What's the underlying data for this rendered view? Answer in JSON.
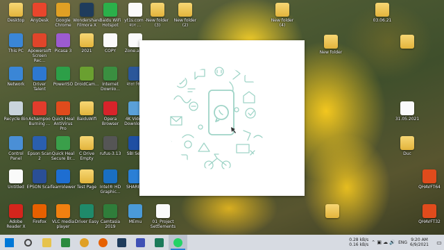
{
  "desktop": {
    "icons_col1": [
      {
        "label": "Desktop",
        "icon": "desktop-folder-icon",
        "color": "#e6c34d"
      },
      {
        "label": "This PC",
        "icon": "this-pc-icon",
        "color": "#3a86d6"
      },
      {
        "label": "Network",
        "icon": "network-icon",
        "color": "#3a86d6"
      },
      {
        "label": "Recycle Bin",
        "icon": "recycle-bin-icon",
        "color": "#c9d4dc"
      },
      {
        "label": "Control\nPanel",
        "icon": "control-panel-icon",
        "color": "#4a8fd6"
      },
      {
        "label": "Untitled",
        "icon": "untitled-file-icon",
        "color": "#f3f3f3"
      },
      {
        "label": "Adobe\nReader X",
        "icon": "adobe-reader-icon",
        "color": "#d4251c"
      }
    ],
    "icons_col2": [
      {
        "label": "AnyDesk",
        "icon": "anydesk-icon",
        "color": "#e8452c"
      },
      {
        "label": "Apowersoft\nScreen Rec...",
        "icon": "apowersoft-icon",
        "color": "#e0452a"
      },
      {
        "label": "Driver Talent",
        "icon": "driver-talent-icon",
        "color": "#2d78d0"
      },
      {
        "label": "Ashampoo\nBurning ...",
        "icon": "ashampoo-icon",
        "color": "#e23c2c"
      },
      {
        "label": "Epson Scan 2",
        "icon": "epson-scan2-icon",
        "color": "#2a5fae"
      },
      {
        "label": "EPSON Scan",
        "icon": "epson-scan-icon",
        "color": "#2a4f96"
      },
      {
        "label": "Firefox",
        "icon": "firefox-icon",
        "color": "#e66000"
      }
    ],
    "icons_col3": [
      {
        "label": "Google\nChrome",
        "icon": "chrome-icon",
        "color": "#e0a024"
      },
      {
        "label": "Picasa 3",
        "icon": "picasa-icon",
        "color": "#9c5bd0"
      },
      {
        "label": "PowerISO",
        "icon": "poweriso-icon",
        "color": "#2d9f48"
      },
      {
        "label": "Quick Heal\nAntiVirus Pro",
        "icon": "quickheal-icon",
        "color": "#e04b1c"
      },
      {
        "label": "Quick Heal\nSecure Br...",
        "icon": "quickheal-secure-icon",
        "color": "#3a9f4a"
      },
      {
        "label": "TeamViewer",
        "icon": "teamviewer-icon",
        "color": "#1e6ed1"
      },
      {
        "label": "VLC media\nplayer",
        "icon": "vlc-icon",
        "color": "#f08010"
      }
    ],
    "icons_col4": [
      {
        "label": "Wondershare\nFilmora X",
        "icon": "filmora-icon",
        "color": "#1f3c5c"
      },
      {
        "label": "2021",
        "icon": "folder-icon",
        "color": "#e6c34d"
      },
      {
        "label": "DroidCam...",
        "icon": "droidcam-icon",
        "color": "#6aa030"
      },
      {
        "label": "BaiduWifi",
        "icon": "folder-icon",
        "color": "#e6c34d"
      },
      {
        "label": "C Drive\nEmpty",
        "icon": "folder-icon",
        "color": "#e6c34d"
      },
      {
        "label": "Test Page",
        "icon": "folder-icon",
        "color": "#e6c34d"
      },
      {
        "label": "Driver Easy",
        "icon": "driver-easy-icon",
        "color": "#1f8a6a"
      }
    ],
    "icons_col5": [
      {
        "label": "Baidu WiFi\nHotspot",
        "icon": "baidu-wifi-icon",
        "color": "#2bb04a"
      },
      {
        "label": "COPY",
        "icon": "file-icon",
        "color": "#f3f3f3"
      },
      {
        "label": "Internet\nDownlo...",
        "icon": "idm-icon",
        "color": "#3a8f40"
      },
      {
        "label": "Opera\nBrowser",
        "icon": "opera-icon",
        "color": "#d8232a"
      },
      {
        "label": "rufus-3.13",
        "icon": "rufus-icon",
        "color": "#555555"
      },
      {
        "label": "Intel® HD\nGraphic...",
        "icon": "intel-graphics-icon",
        "color": "#1a6fc2"
      },
      {
        "label": "Camtasia\n2019",
        "icon": "camtasia-icon",
        "color": "#2f7d3a"
      }
    ],
    "icons_col6": [
      {
        "label": "yt1s.com -\nমনে ...",
        "icon": "music-file-icon",
        "color": "#f3f3f3"
      },
      {
        "label": "Zone.ad...",
        "icon": "file-icon",
        "color": "#f3f3f3"
      },
      {
        "label": "মাতা কি...",
        "icon": "word-file-icon",
        "color": "#2b579a"
      },
      {
        "label": "4K Vide...\nDownloa...",
        "icon": "4k-video-icon",
        "color": "#5aa0d8"
      },
      {
        "label": "SBI Se...",
        "icon": "sbi-icon",
        "color": "#1e4fa3"
      },
      {
        "label": "SHARE...",
        "icon": "shareit-icon",
        "color": "#2a7fd6"
      },
      {
        "label": "MEmu",
        "icon": "memu-icon",
        "color": "#4a9ad8"
      }
    ],
    "icons_misc": [
      {
        "label": "New folder\n(3)",
        "icon": "folder-icon",
        "color": "#e6c34d"
      },
      {
        "label": "New folder\n(2)",
        "icon": "folder-icon",
        "color": "#e6c34d"
      },
      {
        "label": "New folder\n(4)",
        "icon": "folder-icon",
        "color": "#e6c34d"
      },
      {
        "label": "03.06.21",
        "icon": "folder-icon",
        "color": "#e6c34d"
      },
      {
        "label": "New folder",
        "icon": "folder-icon",
        "color": "#e6c34d"
      },
      {
        "label": "",
        "icon": "folder-icon",
        "color": "#e6c34d"
      },
      {
        "label": "31.05.2021",
        "icon": "file-icon",
        "color": "#f3f3f3"
      },
      {
        "label": "Duc",
        "icon": "folder-icon",
        "color": "#e6c34d"
      },
      {
        "label": "QHAVFT64",
        "icon": "qhavft64-icon",
        "color": "#e04b1c"
      },
      {
        "label": "QHAVFT32",
        "icon": "qhavft32-icon",
        "color": "#e04b1c"
      },
      {
        "label": "01_Project\nSettlements",
        "icon": "file-icon",
        "color": "#f3f3f3"
      },
      {
        "label": "",
        "icon": "folder-icon",
        "color": "#e6c34d"
      }
    ]
  },
  "overlay": {
    "accent": "#9fd4c7"
  },
  "taskbar": {
    "items": [
      {
        "icon": "windows-start-icon",
        "color": "#0078d7"
      },
      {
        "icon": "search-icon",
        "color": "#444444"
      },
      {
        "icon": "file-explorer-icon",
        "color": "#e6c34d"
      },
      {
        "icon": "store-icon",
        "color": "#2b8a3e"
      },
      {
        "icon": "chrome-icon",
        "color": "#e0a024"
      },
      {
        "icon": "firefox-icon",
        "color": "#e66000"
      },
      {
        "icon": "filmora-icon",
        "color": "#1f3c5c"
      },
      {
        "icon": "media-player-icon",
        "color": "#3f51b5"
      },
      {
        "icon": "quickheal-icon",
        "color": "#1c7a5a"
      },
      {
        "icon": "whatsapp-icon",
        "color": "#25d366"
      }
    ],
    "network_speed": {
      "up": "0.28 kB/s",
      "down": "0.16 kB/s"
    },
    "language": "ENG",
    "time": "9:20 AM",
    "date": "6/9/2021"
  }
}
